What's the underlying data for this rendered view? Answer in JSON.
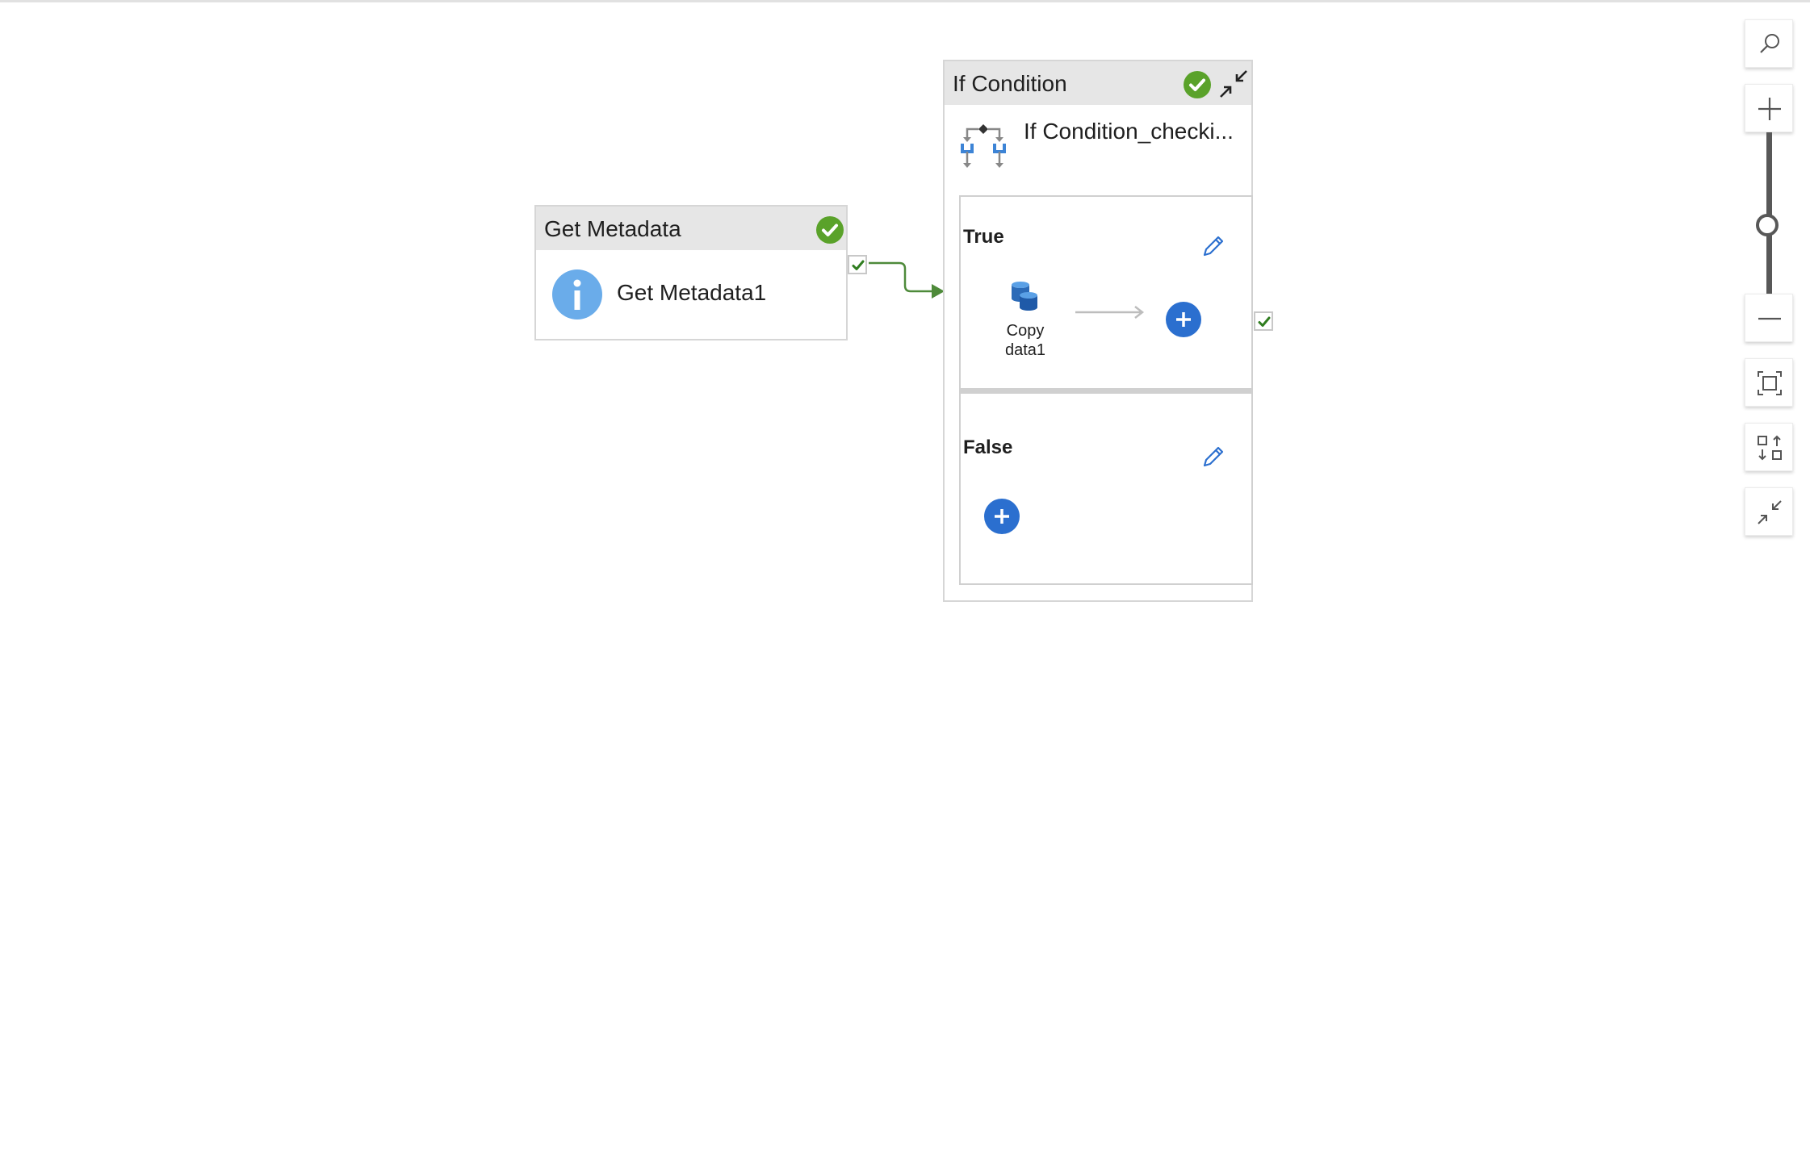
{
  "pipeline": {
    "get_metadata": {
      "type_label": "Get Metadata",
      "name": "Get Metadata1",
      "status": "succeeded"
    },
    "if_condition": {
      "type_label": "If Condition",
      "name": "If Condition_checki...",
      "status": "succeeded",
      "true_branch": {
        "label": "True",
        "activities": [
          {
            "name": "Copy data1",
            "icon": "copy-data-icon"
          }
        ]
      },
      "false_branch": {
        "label": "False",
        "activities": []
      }
    }
  },
  "colors": {
    "success": "#5aa22a",
    "accent": "#2b6fcf",
    "info": "#6aacea",
    "connector": "#4e8a3a"
  },
  "toolbar": {
    "icons": [
      "search-icon",
      "zoom-in-icon",
      "zoom-out-icon",
      "fit-to-screen-icon",
      "auto-align-icon",
      "collapse-all-icon"
    ]
  }
}
